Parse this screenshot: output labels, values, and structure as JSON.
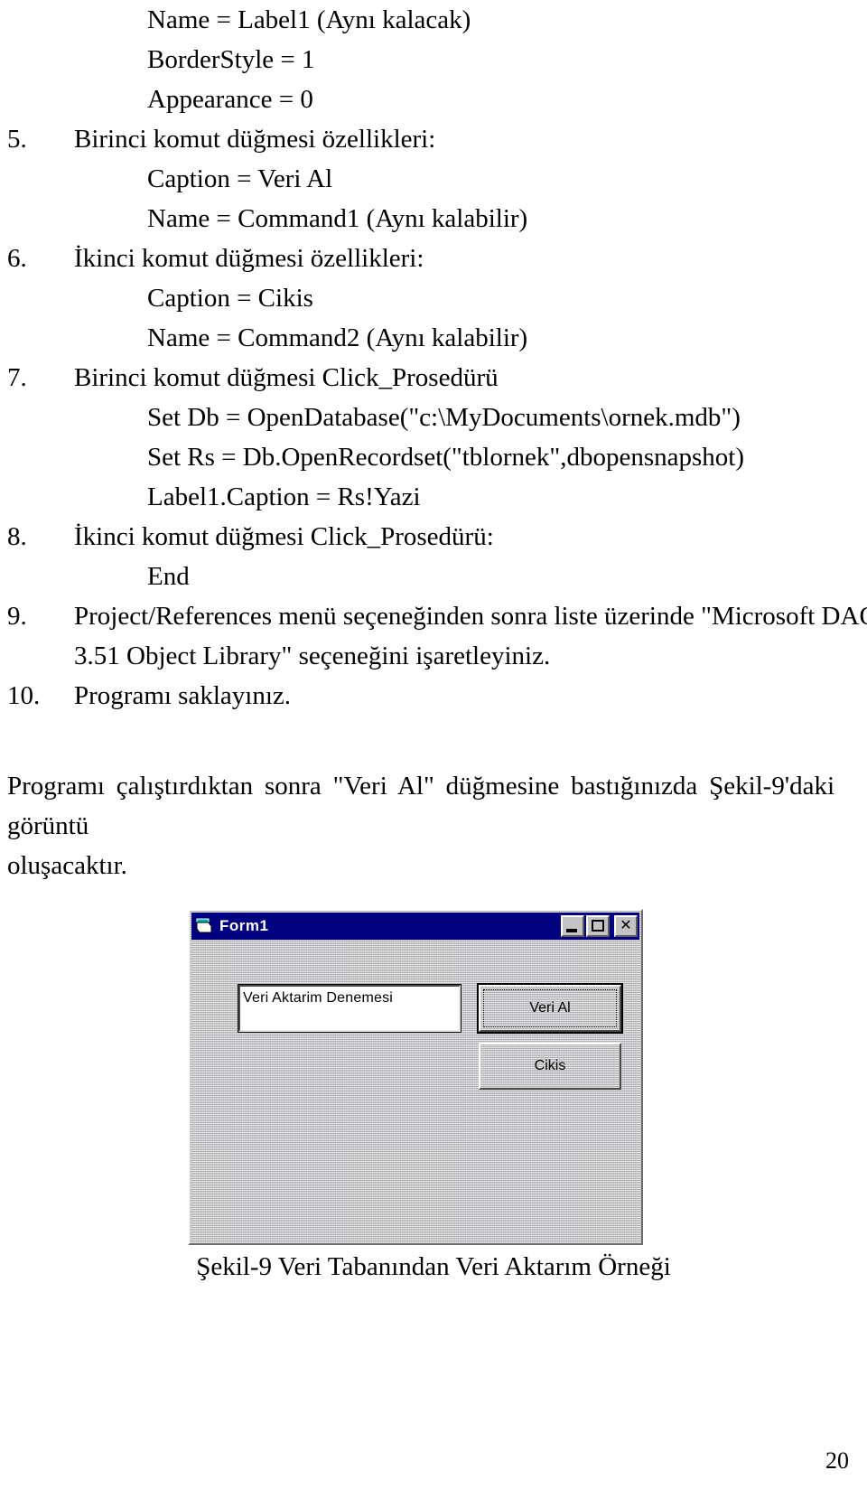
{
  "document": {
    "page_number": "20",
    "figure_caption": "Şekil-9 Veri Tabanından Veri Aktarım Örneği"
  },
  "content_lines": [
    {
      "number": "",
      "text": "Name = Label1 (Aynı kalacak)",
      "indent": "sub"
    },
    {
      "number": "",
      "text": "BorderStyle = 1",
      "indent": "sub"
    },
    {
      "number": "",
      "text": "Appearance = 0",
      "indent": "sub"
    },
    {
      "number": "5.",
      "text": "Birinci komut düğmesi özellikleri:",
      "indent": "num"
    },
    {
      "number": "",
      "text": "Caption = Veri Al",
      "indent": "sub"
    },
    {
      "number": "",
      "text": "Name = Command1 (Aynı kalabilir)",
      "indent": "sub"
    },
    {
      "number": "6.",
      "text": "İkinci komut düğmesi özellikleri:",
      "indent": "num"
    },
    {
      "number": "",
      "text": "Caption = Cikis",
      "indent": "sub"
    },
    {
      "number": "",
      "text": "Name = Command2 (Aynı kalabilir)",
      "indent": "sub"
    },
    {
      "number": "7.",
      "text": "Birinci komut düğmesi  Click_Prosedürü",
      "indent": "num"
    },
    {
      "number": "",
      "text": "Set Db = OpenDatabase(\"c:\\MyDocuments\\ornek.mdb\")",
      "indent": "sub"
    },
    {
      "number": "",
      "text": "Set Rs = Db.OpenRecordset(\"tblornek\",dbopensnapshot)",
      "indent": "sub"
    },
    {
      "number": "",
      "text": "Label1.Caption = Rs!Yazi",
      "indent": "sub"
    },
    {
      "number": "8.",
      "text": "İkinci komut düğmesi Click_Prosedürü:",
      "indent": "num"
    },
    {
      "number": "",
      "text": "End",
      "indent": "sub"
    },
    {
      "number": "9.",
      "text": "",
      "indent": "justified",
      "text_lines": [
        "Project/References menü seçeneğinden sonra liste üzerinde \"Microsoft DAO",
        "3.51 Object Library\" seçeneğini işaretleyiniz."
      ]
    },
    {
      "number": "10.",
      "text": "Programı saklayınız.",
      "indent": "num"
    }
  ],
  "paragraph": {
    "line1": "Programı çalıştırdıktan sonra \"Veri Al\" düğmesine bastığınızda Şekil-9'daki görüntü",
    "line2": "oluşacaktır."
  },
  "vb_form": {
    "title": "Form1",
    "title_icon": "form-window-icon",
    "titlebar_buttons": [
      {
        "name": "minimize-button",
        "glyph": "minimize-icon"
      },
      {
        "name": "maximize-button",
        "glyph": "maximize-icon"
      },
      {
        "name": "close-button",
        "glyph": "close-icon",
        "label": "✕"
      }
    ],
    "label_caption": "Veri Aktarim Denemesi",
    "buttons": [
      {
        "name": "veri-al-button",
        "caption": "Veri Al",
        "focused": true
      },
      {
        "name": "cikis-button",
        "caption": "Cikis",
        "focused": false
      }
    ],
    "colors": {
      "titlebar": "#000080",
      "titlebar_text": "#ffffff",
      "face": "#c0c0c0",
      "label_background": "#ffffff"
    }
  }
}
